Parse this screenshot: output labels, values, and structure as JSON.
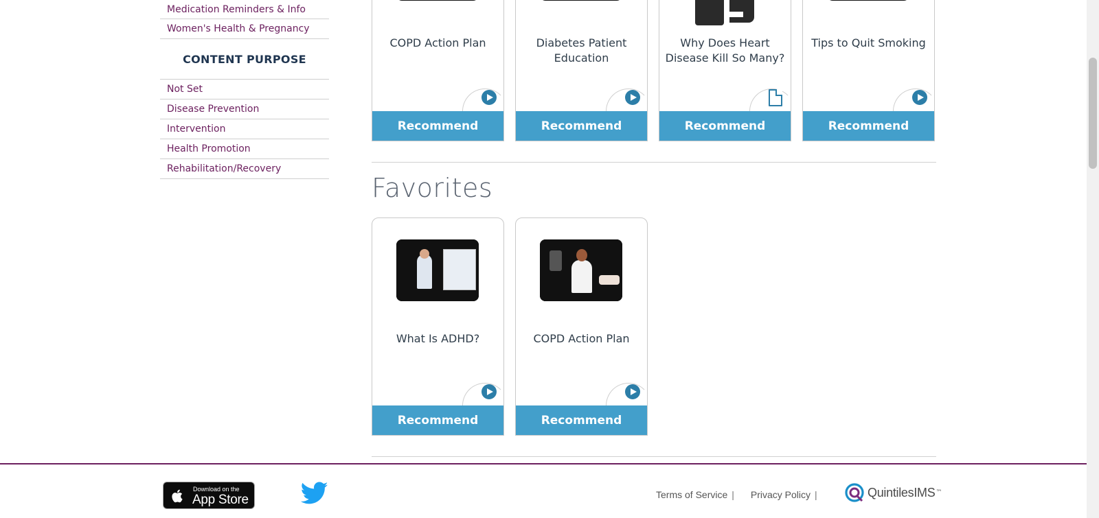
{
  "sidebar": {
    "top_items": [
      {
        "label": "Medication Reminders & Info"
      },
      {
        "label": "Women's Health & Pregnancy"
      }
    ],
    "purpose_heading": "CONTENT PURPOSE",
    "purpose_items": [
      {
        "label": "Not Set"
      },
      {
        "label": "Disease Prevention"
      },
      {
        "label": "Intervention"
      },
      {
        "label": "Health Promotion"
      },
      {
        "label": "Rehabilitation/Recovery"
      }
    ]
  },
  "top_cards": [
    {
      "title": "COPD Action Plan",
      "type_icon": "play-icon",
      "button": "Recommend"
    },
    {
      "title": "Diabetes Patient Education",
      "type_icon": "play-icon",
      "button": "Recommend"
    },
    {
      "title": "Why Does Heart Disease Kill So Many?",
      "type_icon": "document-icon",
      "button": "Recommend"
    },
    {
      "title": "Tips to Quit Smoking",
      "type_icon": "play-icon",
      "button": "Recommend"
    }
  ],
  "favorites": {
    "title": "Favorites",
    "cards": [
      {
        "title": "What Is ADHD?",
        "type_icon": "play-icon",
        "button": "Recommend"
      },
      {
        "title": "COPD Action Plan",
        "type_icon": "play-icon",
        "button": "Recommend"
      }
    ]
  },
  "footer": {
    "app_store_small": "Download on the",
    "app_store_big": "App Store",
    "terms": "Terms of Service",
    "privacy": "Privacy Policy",
    "separator": "|",
    "brand": "QuintilesIMS",
    "brand_tm": "™"
  },
  "colors": {
    "accent": "#439fcb",
    "link": "#6b1f5e",
    "play": "#2c7ea8"
  }
}
